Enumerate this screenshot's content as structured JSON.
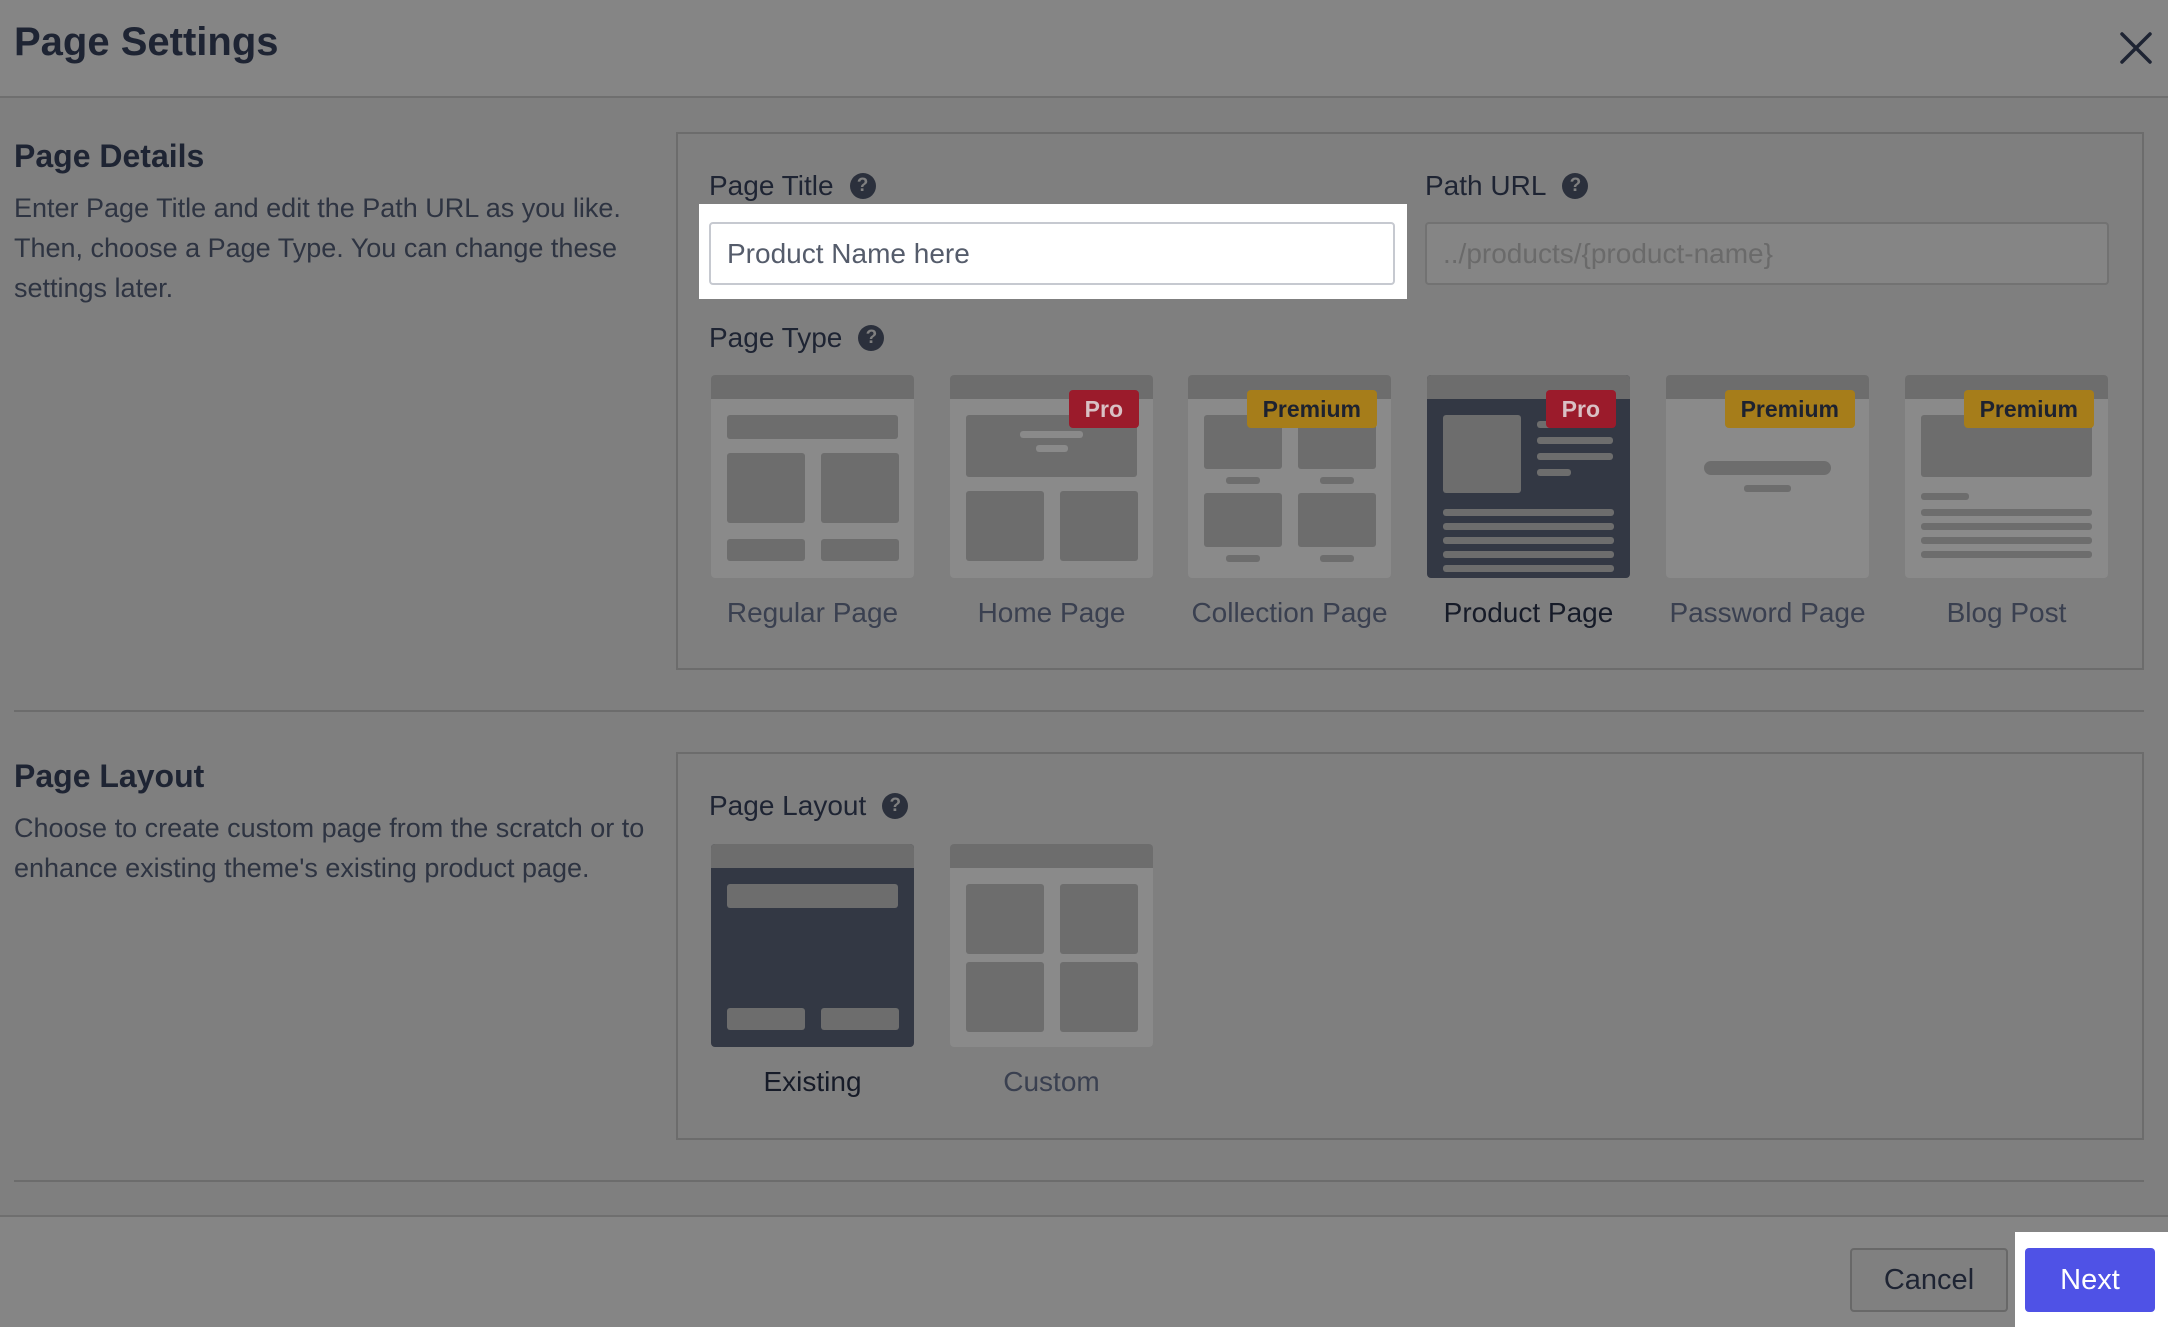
{
  "header": {
    "title": "Page Settings",
    "close_icon": "close-icon"
  },
  "page_details": {
    "title": "Page Details",
    "description": "Enter Page Title and edit the Path URL as you like. Then, choose a Page Type. You can change these settings later.",
    "page_title_label": "Page Title",
    "page_title_value": "",
    "page_title_placeholder": "Product Name here",
    "path_url_label": "Path URL",
    "path_url_value": "",
    "path_url_placeholder": "../products/{product-name}",
    "page_type_label": "Page Type",
    "page_types": [
      {
        "label": "Regular Page",
        "badge": "",
        "selected": false
      },
      {
        "label": "Home Page",
        "badge": "Pro",
        "selected": false
      },
      {
        "label": "Collection Page",
        "badge": "Premium",
        "selected": false
      },
      {
        "label": "Product Page",
        "badge": "Pro",
        "selected": true
      },
      {
        "label": "Password Page",
        "badge": "Premium",
        "selected": false
      },
      {
        "label": "Blog Post",
        "badge": "Premium",
        "selected": false
      }
    ]
  },
  "page_layout": {
    "title": "Page Layout",
    "description": "Choose to create custom page from the scratch or to enhance existing theme's existing product page.",
    "layout_label": "Page Layout",
    "layouts": [
      {
        "label": "Existing",
        "selected": true
      },
      {
        "label": "Custom",
        "selected": false
      }
    ]
  },
  "footer": {
    "cancel_label": "Cancel",
    "next_label": "Next"
  },
  "colors": {
    "overlay": "#7f7f7f",
    "primary": "#4f52e6",
    "pro_badge": "#9b1b2b",
    "premium_badge": "#a67d1a",
    "selected_thumb": "#333844"
  }
}
